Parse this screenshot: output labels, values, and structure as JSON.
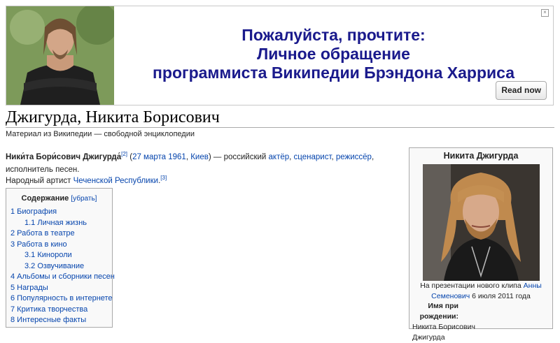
{
  "banner": {
    "line1": "Пожалуйста, прочтите:",
    "line2": "Личное обращение",
    "line3": "программиста Википедии Брэндона Харриса",
    "button": "Read now"
  },
  "article": {
    "title": "Джигурда, Никита Борисович",
    "tagline": "Материал из Википедии — свободной энциклопедии",
    "intro": {
      "name": "Ники́та Бори́сович Джигурда́",
      "ref2": "[2]",
      "open_paren": " (",
      "birth_date": "27 марта 1961",
      "comma": ", ",
      "birth_city": "Киев",
      "mid": ") — российский ",
      "prof1": "актёр",
      "prof2": "сценарист",
      "prof3": "режиссёр",
      "tail": ", исполнитель песен."
    },
    "people_artist": {
      "prefix": "Народный артист ",
      "republic": "Чеченской Республики",
      "ref3": "[3]"
    }
  },
  "toc": {
    "title": "Содержание",
    "toggle": "[убрать]",
    "items": [
      {
        "label": "1 Биография",
        "sub": false
      },
      {
        "label": "1.1 Личная жизнь",
        "sub": true
      },
      {
        "label": "2 Работа в театре",
        "sub": false
      },
      {
        "label": "3 Работа в кино",
        "sub": false
      },
      {
        "label": "3.1 Кинороли",
        "sub": true
      },
      {
        "label": "3.2 Озвучивание",
        "sub": true
      },
      {
        "label": "4 Альбомы и сборники песен",
        "sub": false
      },
      {
        "label": "5 Награды",
        "sub": false
      },
      {
        "label": "6 Популярность в интернете",
        "sub": false
      },
      {
        "label": "7 Критика творчества",
        "sub": false
      },
      {
        "label": "8 Интересные факты",
        "sub": false
      }
    ]
  },
  "infobox": {
    "title": "Никита Джигурда",
    "caption_prefix": "На презентации нового клипа ",
    "caption_link": "Анны Семенович",
    "caption_suffix": " 6 июля 2011 года",
    "birth_name_label": "Имя при рождении:",
    "birth_name_value": "Никита Борисович Джигурда"
  }
}
